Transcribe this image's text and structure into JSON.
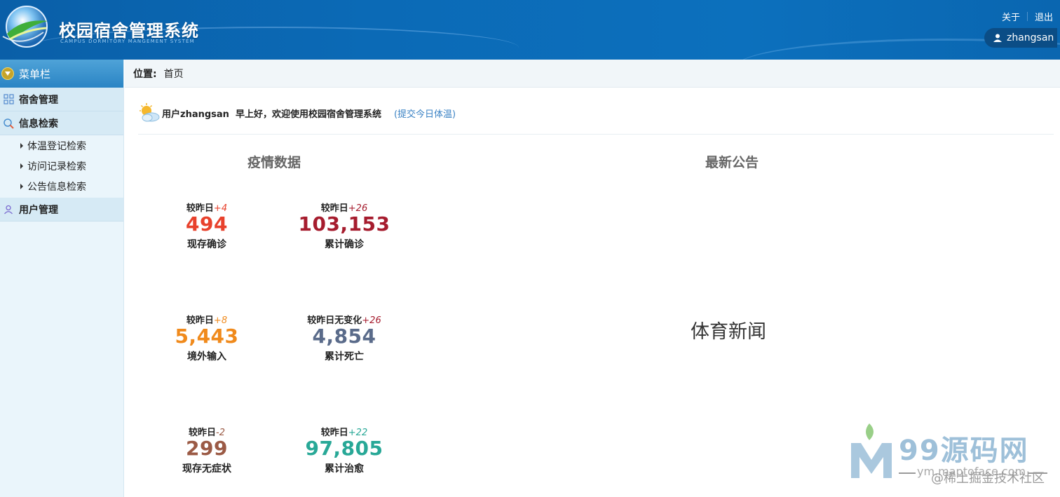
{
  "header": {
    "title": "校园宿舍管理系统",
    "subtitle": "CAMPUS DORMITORY MANGEMENT SYSTEM",
    "about": "关于",
    "logout": "退出",
    "username": "zhangsan"
  },
  "sidebar": {
    "menu_title": "菜单栏",
    "groups": [
      {
        "label": "宿舍管理",
        "icon": "grid-icon"
      },
      {
        "label": "信息检索",
        "icon": "search-icon",
        "items": [
          "体温登记检索",
          "访问记录检索",
          "公告信息检索"
        ]
      },
      {
        "label": "用户管理",
        "icon": "user-icon"
      }
    ]
  },
  "location": {
    "label": "位置:",
    "value": "首页"
  },
  "welcome": {
    "text": "用户zhangsan  早上好，欢迎使用校园宿舍管理系统",
    "link": "(提交今日体温)"
  },
  "epidemic": {
    "title": "疫情数据",
    "stats": [
      {
        "cmp": "较昨日",
        "delta": "+4",
        "value": "494",
        "label": "现存确诊",
        "color": "#e8412c",
        "delta_color": "#e8412c"
      },
      {
        "cmp": "较昨日",
        "delta": "+26",
        "value": "103,153",
        "label": "累计确诊",
        "color": "#a61c2e",
        "delta_color": "#a61c2e"
      },
      {
        "cmp": "较昨日",
        "delta": "+8",
        "value": "5,443",
        "label": "境外输入",
        "color": "#f08a1c",
        "delta_color": "#f08a1c"
      },
      {
        "cmp": "较昨日无变化",
        "delta": "+26",
        "value": "4,854",
        "label": "累计死亡",
        "color": "#5a6b8a",
        "delta_color": "#a61c2e"
      },
      {
        "cmp": "较昨日",
        "delta": "-2",
        "value": "299",
        "label": "现存无症状",
        "color": "#9b5a45",
        "delta_color": "#9b5a45"
      },
      {
        "cmp": "较昨日",
        "delta": "+22",
        "value": "97,805",
        "label": "累计治愈",
        "color": "#28a897",
        "delta_color": "#28a897"
      }
    ]
  },
  "notice": {
    "title": "最新公告",
    "news": "体育新闻"
  },
  "watermark": {
    "brand": "99源码网",
    "url": "ym.maptoface.com",
    "community": "@稀土掘金技术社区"
  }
}
